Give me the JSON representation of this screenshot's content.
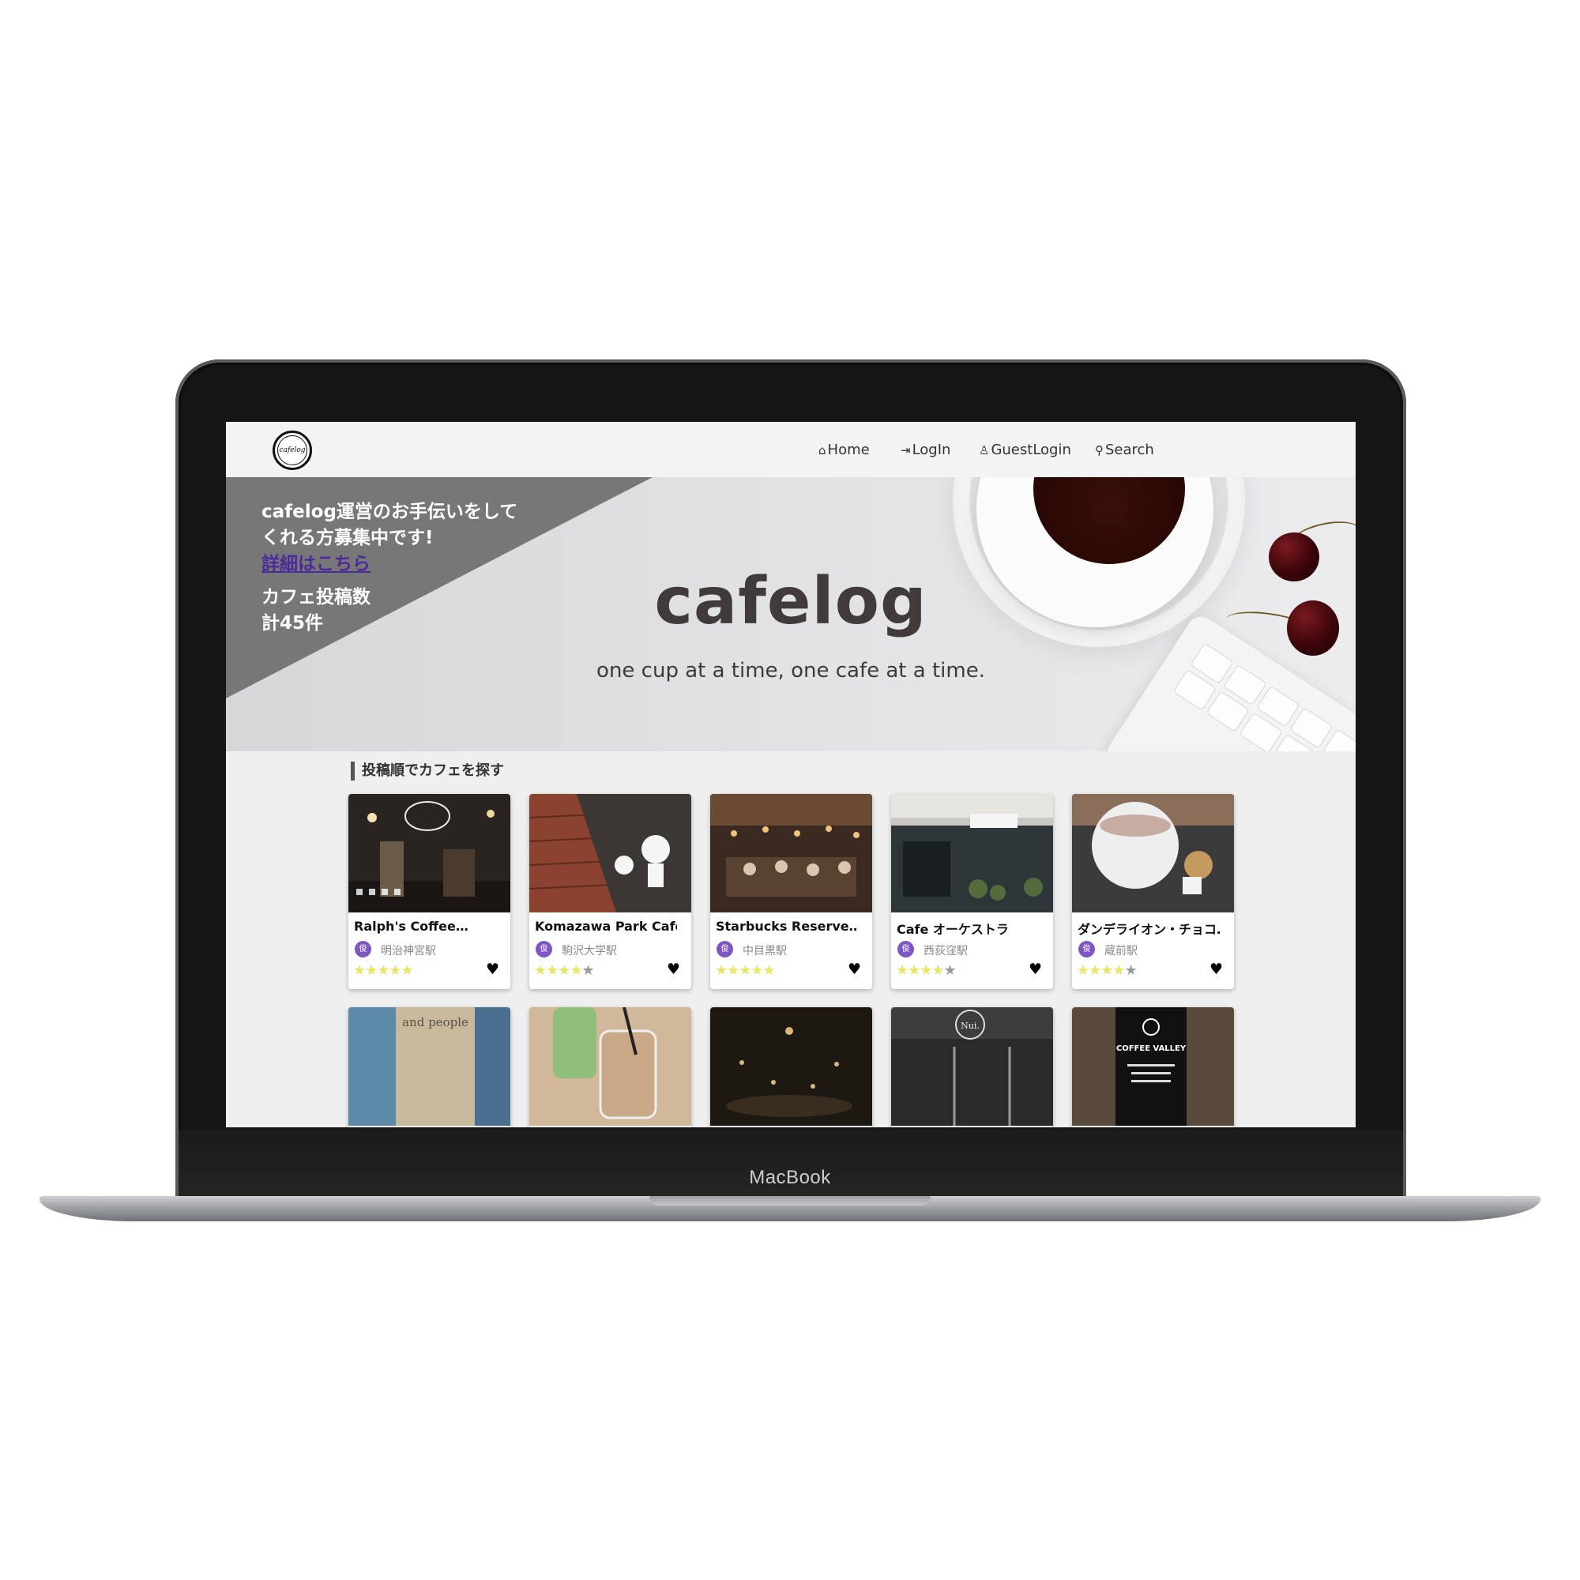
{
  "device": {
    "brand_label": "MacBook"
  },
  "nav": {
    "logo_text": "cafelog",
    "items": [
      {
        "icon": "home-icon",
        "glyph": "⌂",
        "label": "Home"
      },
      {
        "icon": "login-icon",
        "glyph": "⇥",
        "label": "LogIn"
      },
      {
        "icon": "guest-icon",
        "glyph": "♙",
        "label": "GuestLogin"
      },
      {
        "icon": "search-icon",
        "glyph": "⚲",
        "label": "Search"
      }
    ]
  },
  "hero": {
    "banner_line1": "cafelog運営のお手伝いをして",
    "banner_line2": "くれる方募集中です!",
    "banner_link": "詳細はこちら",
    "count_label": "カフェ投稿数",
    "count_value": "計45件",
    "title": "cafelog",
    "subtitle": "one cup at a time, one cafe at a time."
  },
  "section": {
    "heading": "投稿順でカフェを探す"
  },
  "colors": {
    "accent_purple": "#7e57c2",
    "link_purple": "#4b2a9c",
    "star_yellow": "#e9e46a"
  },
  "cards": [
    {
      "title": "Ralph's Coffee…",
      "avatar": "俊",
      "station": "明治神宮駅",
      "rating": 5
    },
    {
      "title": "Komazawa Park Cafe",
      "avatar": "俊",
      "station": "駒沢大学駅",
      "rating": 4
    },
    {
      "title": "Starbucks Reserve…",
      "avatar": "俊",
      "station": "中目黒駅",
      "rating": 5
    },
    {
      "title": "Cafe オーケストラ",
      "avatar": "俊",
      "station": "西荻窪駅",
      "rating": 4
    },
    {
      "title": "ダンデライオン・チョコ…",
      "avatar": "俊",
      "station": "蔵前駅",
      "rating": 4
    }
  ],
  "cards_row2": [
    {
      "photo_text": "and people"
    },
    {
      "photo_text": ""
    },
    {
      "photo_text": ""
    },
    {
      "photo_text": "Nui."
    },
    {
      "photo_text": "COFFEE VALLEY"
    }
  ]
}
